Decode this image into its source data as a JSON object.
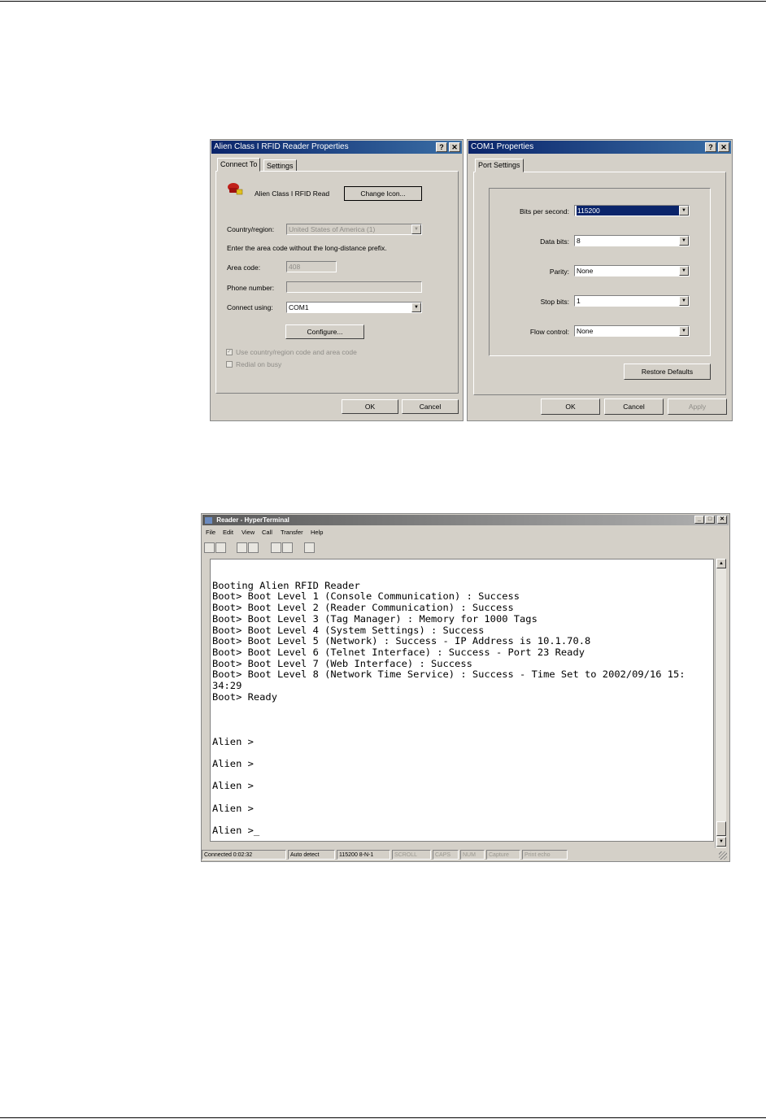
{
  "dialog_reader": {
    "title": "Alien Class I RFID Reader Properties",
    "tabs": [
      "Connect To",
      "Settings"
    ],
    "entry_name": "Alien Class I RFID Read",
    "change_icon_button": "Change Icon...",
    "country_label": "Country/region:",
    "country_value": "United States of America (1)",
    "hint": "Enter the area code without the long-distance prefix.",
    "area_code_label": "Area code:",
    "area_code_value": "408",
    "phone_label": "Phone number:",
    "phone_value": "",
    "connect_using_label": "Connect using:",
    "connect_using_value": "COM1",
    "configure_button": "Configure...",
    "use_country_checkbox": "Use country/region code and area code",
    "redial_checkbox": "Redial on busy",
    "ok_button": "OK",
    "cancel_button": "Cancel",
    "help_glyph": "?",
    "close_glyph": "✕"
  },
  "dialog_com1": {
    "title": "COM1 Properties",
    "tab": "Port Settings",
    "fields": [
      {
        "label": "Bits per second:",
        "value": "115200"
      },
      {
        "label": "Data bits:",
        "value": "8"
      },
      {
        "label": "Parity:",
        "value": "None"
      },
      {
        "label": "Stop bits:",
        "value": "1"
      },
      {
        "label": "Flow control:",
        "value": "None"
      }
    ],
    "restore_button": "Restore Defaults",
    "ok_button": "OK",
    "cancel_button": "Cancel",
    "apply_button": "Apply",
    "help_glyph": "?",
    "close_glyph": "✕"
  },
  "hyperterminal": {
    "title": "Reader - HyperTerminal",
    "menu": [
      "File",
      "Edit",
      "View",
      "Call",
      "Transfer",
      "Help"
    ],
    "window_buttons": [
      "_",
      "□",
      "✕"
    ],
    "terminal_lines": [
      "",
      "Booting Alien RFID Reader",
      "Boot> Boot Level 1 (Console Communication) : Success",
      "Boot> Boot Level 2 (Reader Communication) : Success",
      "Boot> Boot Level 3 (Tag Manager) : Memory for 1000 Tags",
      "Boot> Boot Level 4 (System Settings) : Success",
      "Boot> Boot Level 5 (Network) : Success - IP Address is 10.1.70.8",
      "Boot> Boot Level 6 (Telnet Interface) : Success - Port 23 Ready",
      "Boot> Boot Level 7 (Web Interface) : Success",
      "Boot> Boot Level 8 (Network Time Service) : Success - Time Set to 2002/09/16 15:",
      "34:29",
      "Boot> Ready",
      "",
      "",
      "",
      "Alien >",
      "",
      "Alien >",
      "",
      "Alien >",
      "",
      "Alien >",
      "",
      "Alien >_"
    ],
    "status_bar": [
      "Connected 0:02:32",
      "Auto detect",
      "115200 8-N-1",
      "SCROLL",
      "CAPS",
      "NUM",
      "Capture",
      "Print echo"
    ]
  }
}
